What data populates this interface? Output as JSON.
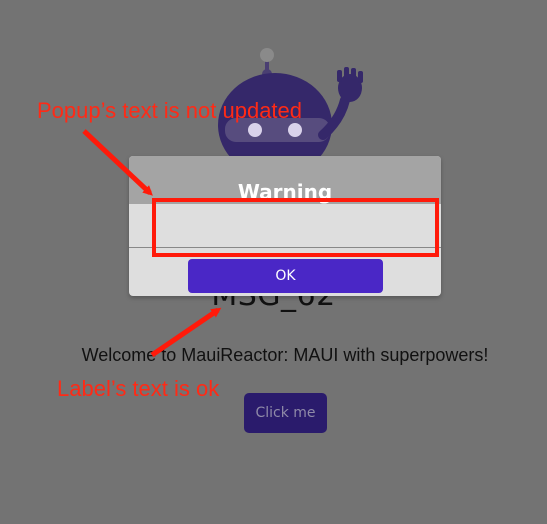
{
  "app": {
    "heading": "MSG_62",
    "welcome_text": "Welcome to MauiReactor: MAUI with superpowers!",
    "click_button_label": "Click me"
  },
  "popup": {
    "title": "Warning",
    "message": "",
    "ok_label": "OK"
  },
  "annotations": {
    "popup_note": "Popup’s text is not updated",
    "label_note": "Label’s text is ok",
    "color": "#ff2a16"
  },
  "icons": {
    "mascot": "dotnet-bot-icon"
  }
}
